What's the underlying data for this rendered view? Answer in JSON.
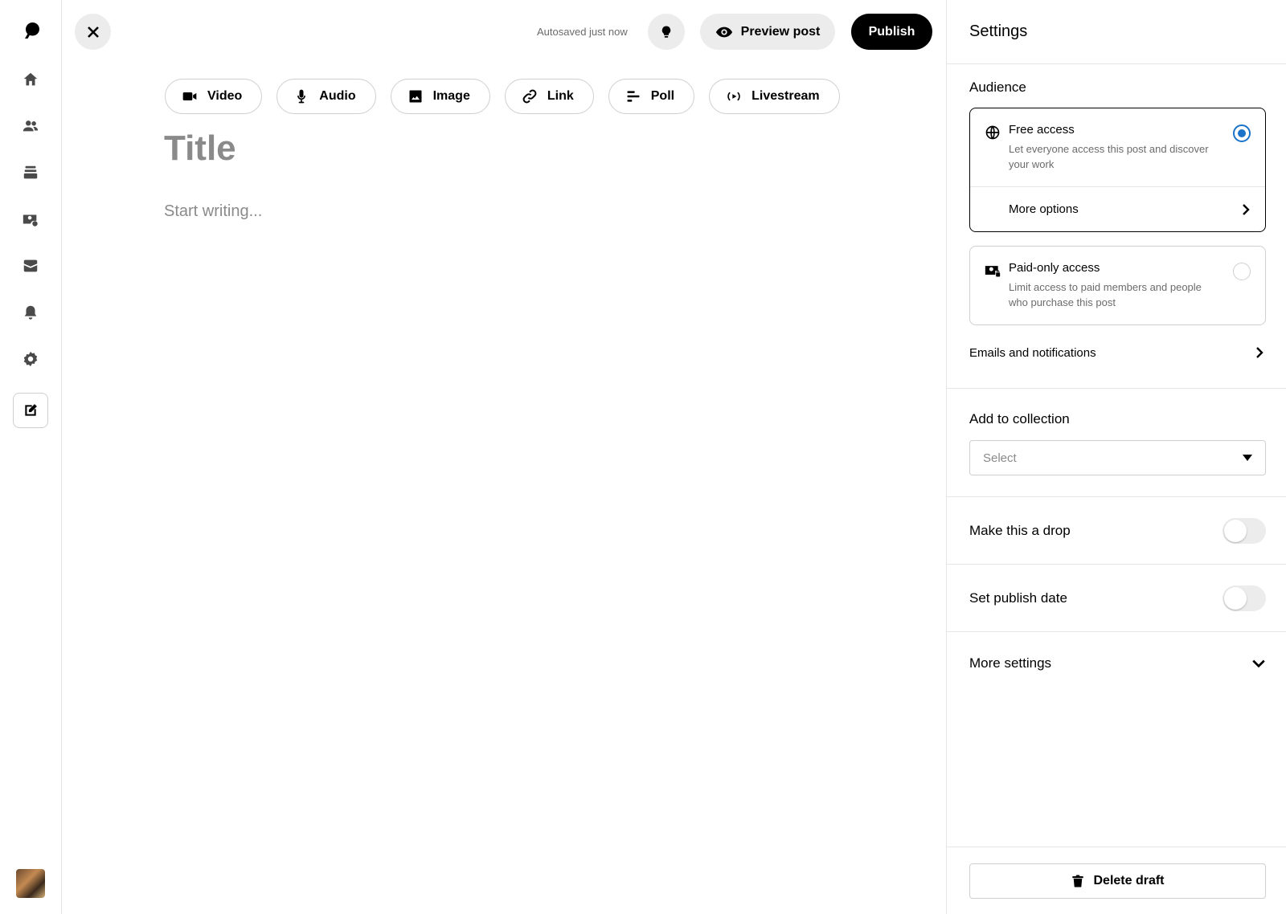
{
  "header": {
    "autosave_status": "Autosaved just now",
    "preview_label": "Preview post",
    "publish_label": "Publish"
  },
  "left_nav": {
    "items": [
      "logo-icon",
      "home-icon",
      "members-icon",
      "library-icon",
      "money-icon",
      "inbox-icon",
      "bell-icon",
      "settings-icon",
      "create-post-icon"
    ]
  },
  "media_toolbar": {
    "items": [
      {
        "label": "Video",
        "icon": "video-icon"
      },
      {
        "label": "Audio",
        "icon": "microphone-icon"
      },
      {
        "label": "Image",
        "icon": "image-icon"
      },
      {
        "label": "Link",
        "icon": "link-icon"
      },
      {
        "label": "Poll",
        "icon": "poll-icon"
      },
      {
        "label": "Livestream",
        "icon": "livestream-icon"
      }
    ]
  },
  "editor": {
    "title_placeholder": "Title",
    "body_placeholder": "Start writing..."
  },
  "settings": {
    "title": "Settings",
    "audience": {
      "heading": "Audience",
      "free": {
        "title": "Free access",
        "description": "Let everyone access this post and discover your work",
        "selected": true,
        "more_options": "More options"
      },
      "paid": {
        "title": "Paid-only access",
        "description": "Limit access to paid members and people who purchase this post",
        "selected": false
      },
      "emails_link": "Emails and notifications"
    },
    "collection": {
      "heading": "Add to collection",
      "select_placeholder": "Select"
    },
    "drop": {
      "label": "Make this a drop",
      "enabled": false
    },
    "publish_date": {
      "label": "Set publish date",
      "enabled": false
    },
    "more_settings": "More settings",
    "delete_label": "Delete draft"
  },
  "colors": {
    "accent": "#1a73c8",
    "primary_button": "#000000",
    "secondary_button": "#ececec"
  }
}
